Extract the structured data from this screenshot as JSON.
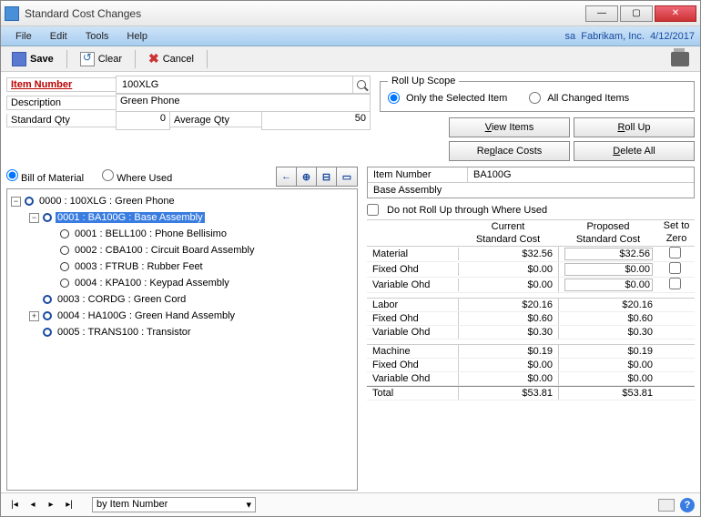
{
  "window": {
    "title": "Standard Cost Changes"
  },
  "menubar": {
    "items": [
      "File",
      "Edit",
      "Tools",
      "Help"
    ],
    "context_user": "sa",
    "context_company": "Fabrikam, Inc.",
    "context_date": "4/12/2017"
  },
  "toolbar": {
    "save": "Save",
    "clear": "Clear",
    "cancel": "Cancel"
  },
  "item_header": {
    "item_number_label": "Item Number",
    "item_number_value": "100XLG",
    "description_label": "Description",
    "description_value": "Green Phone",
    "standard_qty_label": "Standard Qty",
    "standard_qty_value": "0",
    "average_qty_label": "Average Qty",
    "average_qty_value": "50"
  },
  "rollup_scope": {
    "legend": "Roll Up Scope",
    "only_selected": "Only the Selected Item",
    "all_changed": "All Changed Items",
    "selected": "only_selected"
  },
  "action_buttons": {
    "view_items": "View Items",
    "roll_up": "Roll Up",
    "replace_costs": "Replace Costs",
    "delete_all": "Delete All"
  },
  "view_mode": {
    "bill_of_material": "Bill of Material",
    "where_used": "Where Used",
    "selected": "bill_of_material"
  },
  "tree": {
    "root": "0000 : 100XLG  :  Green Phone",
    "items": [
      {
        "id": "0001",
        "code": "BA100G",
        "desc": "Base Assembly",
        "selected": true,
        "expandable": true,
        "expanded": true,
        "children": [
          {
            "id": "0001",
            "code": "BELL100",
            "desc": "Phone Bellisimo"
          },
          {
            "id": "0002",
            "code": "CBA100",
            "desc": "Circuit Board Assembly"
          },
          {
            "id": "0003",
            "code": "FTRUB",
            "desc": "Rubber Feet"
          },
          {
            "id": "0004",
            "code": "KPA100",
            "desc": "Keypad Assembly"
          }
        ]
      },
      {
        "id": "0003",
        "code": "CORDG",
        "desc": "Green Cord"
      },
      {
        "id": "0004",
        "code": "HA100G",
        "desc": "Green Hand Assembly",
        "expandable": true,
        "expanded": false
      },
      {
        "id": "0005",
        "code": "TRANS100",
        "desc": "Transistor"
      }
    ]
  },
  "detail": {
    "item_number_label": "Item Number",
    "item_number_value": "BA100G",
    "base_assembly": "Base Assembly"
  },
  "do_not_rollup": {
    "label": "Do not Roll Up through Where Used",
    "checked": false
  },
  "costs": {
    "header_current": "Current",
    "header_std": "Standard Cost",
    "header_proposed": "Proposed",
    "header_setzero": "Set to",
    "header_zero": "Zero",
    "groups": [
      {
        "rows": [
          {
            "label": "Material",
            "current": "$32.56",
            "proposed": "$32.56",
            "editable": true
          },
          {
            "label": "Fixed Ohd",
            "current": "$0.00",
            "proposed": "$0.00",
            "editable": true
          },
          {
            "label": "Variable Ohd",
            "current": "$0.00",
            "proposed": "$0.00",
            "editable": true
          }
        ]
      },
      {
        "rows": [
          {
            "label": "Labor",
            "current": "$20.16",
            "proposed": "$20.16"
          },
          {
            "label": "Fixed Ohd",
            "current": "$0.60",
            "proposed": "$0.60"
          },
          {
            "label": "Variable Ohd",
            "current": "$0.30",
            "proposed": "$0.30"
          }
        ]
      },
      {
        "rows": [
          {
            "label": "Machine",
            "current": "$0.19",
            "proposed": "$0.19"
          },
          {
            "label": "Fixed Ohd",
            "current": "$0.00",
            "proposed": "$0.00"
          },
          {
            "label": "Variable Ohd",
            "current": "$0.00",
            "proposed": "$0.00"
          }
        ]
      }
    ],
    "total": {
      "label": "Total",
      "current": "$53.81",
      "proposed": "$53.81"
    }
  },
  "footer": {
    "sort_by": "by Item Number"
  }
}
